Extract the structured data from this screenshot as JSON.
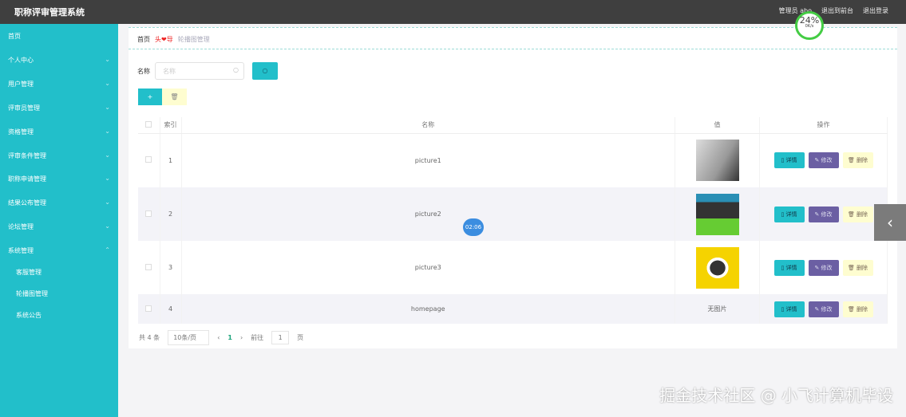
{
  "header": {
    "title": "职称评审管理系统",
    "user": "管理员 abo",
    "front": "退出到前台",
    "logout": "退出登录"
  },
  "sidebar": {
    "items": [
      {
        "label": "首页"
      },
      {
        "label": "个人中心"
      },
      {
        "label": "用户管理"
      },
      {
        "label": "评审员管理"
      },
      {
        "label": "资格管理"
      },
      {
        "label": "评审条件管理"
      },
      {
        "label": "职称申请管理"
      },
      {
        "label": "结果公布管理"
      },
      {
        "label": "论坛管理"
      },
      {
        "label": "系统管理"
      }
    ],
    "sub": [
      {
        "label": "客服管理"
      },
      {
        "label": "轮播图管理"
      },
      {
        "label": "系统公告"
      }
    ]
  },
  "breadcrumb": {
    "home": "首页",
    "deco": "头❤导",
    "current": "轮播图管理"
  },
  "search": {
    "label": "名称",
    "placeholder": "名称"
  },
  "table": {
    "headers": [
      "索引",
      "名称",
      "值",
      "操作"
    ],
    "rows": [
      {
        "index": "1",
        "name": "picture1",
        "value": ""
      },
      {
        "index": "2",
        "name": "picture2",
        "value": ""
      },
      {
        "index": "3",
        "name": "picture3",
        "value": ""
      },
      {
        "index": "4",
        "name": "homepage",
        "value": "无图片"
      }
    ],
    "actions": {
      "detail": "▯ 详情",
      "edit": "✎ 修改",
      "delete": "🗑 删除"
    }
  },
  "pager": {
    "total": "共 4 条",
    "size": "10条/页",
    "page": "1",
    "goto": "前往",
    "goto_value": "1",
    "unit": "页"
  },
  "overlay": {
    "gauge": "24%",
    "speed": "0K/s",
    "timer": "02:06",
    "watermark": "掘金技术社区 @ 小飞计算机毕设"
  }
}
